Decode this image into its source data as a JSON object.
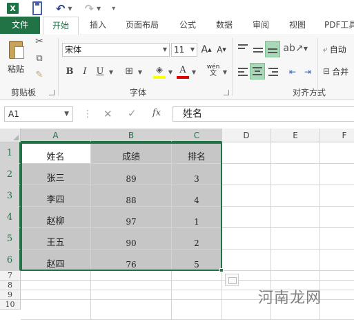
{
  "app": {
    "logo_text": "X"
  },
  "tabs": {
    "file": "文件",
    "items": [
      "开始",
      "插入",
      "页面布局",
      "公式",
      "数据",
      "审阅",
      "视图",
      "PDF工具"
    ]
  },
  "ribbon": {
    "clipboard": {
      "paste_label": "粘贴",
      "group_label": "剪贴板"
    },
    "font": {
      "name": "宋体",
      "size": "11",
      "grow": "A",
      "shrink": "A",
      "bold": "B",
      "italic": "I",
      "underline": "U",
      "font_color_letter": "A",
      "phonetic": "wén",
      "group_label": "字体"
    },
    "alignment": {
      "wrap_label": "自动",
      "merge_label": "合并",
      "group_label": "对齐方式"
    }
  },
  "formula_bar": {
    "cell_ref": "A1",
    "fx": "fx",
    "content": "姓名"
  },
  "sheet": {
    "columns": [
      "A",
      "B",
      "C",
      "D",
      "E",
      "F"
    ],
    "row_numbers": [
      "1",
      "2",
      "3",
      "4",
      "5",
      "6",
      "7",
      "8",
      "9",
      "10"
    ],
    "rows": [
      [
        "姓名",
        "成绩",
        "排名"
      ],
      [
        "张三",
        "89",
        "3"
      ],
      [
        "李四",
        "88",
        "4"
      ],
      [
        "赵柳",
        "97",
        "1"
      ],
      [
        "王五",
        "90",
        "2"
      ],
      [
        "赵四",
        "76",
        "5"
      ]
    ]
  },
  "colors": {
    "accent": "#217346",
    "selection": "#c6c6c6"
  },
  "watermark": "河南龙网"
}
